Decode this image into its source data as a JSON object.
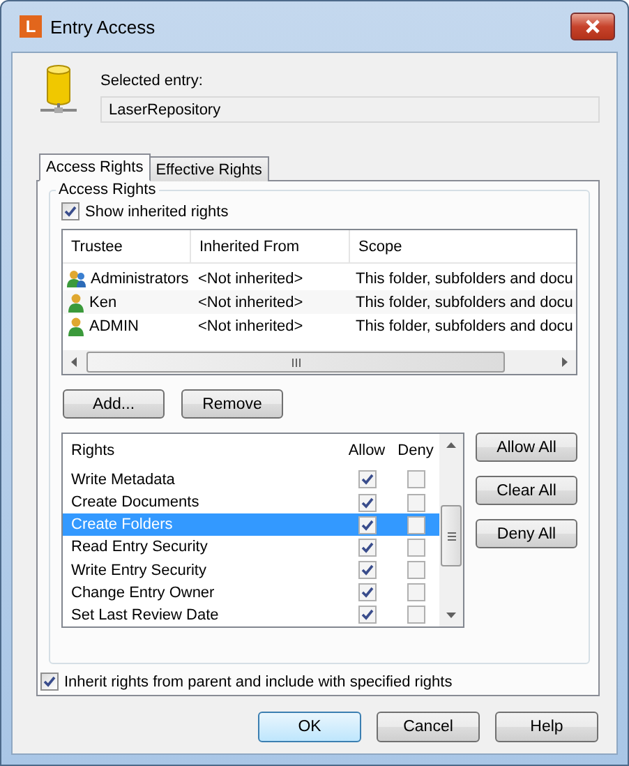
{
  "window": {
    "title": "Entry Access",
    "app_icon_letter": "L"
  },
  "selected_entry": {
    "label": "Selected entry:",
    "value": "LaserRepository"
  },
  "tabs": [
    {
      "label": "Access Rights",
      "selected": true
    },
    {
      "label": "Effective Rights",
      "selected": false
    }
  ],
  "group_label": "Access Rights",
  "show_inherited": {
    "label": "Show inherited rights",
    "checked": true
  },
  "trustees": {
    "columns": [
      "Trustee",
      "Inherited From",
      "Scope"
    ],
    "rows": [
      {
        "kind": "group",
        "trustee": "Administrators",
        "inherited_from": "<Not inherited>",
        "scope": "This folder, subfolders and docu"
      },
      {
        "kind": "user",
        "trustee": "Ken",
        "inherited_from": "<Not inherited>",
        "scope": "This folder, subfolders and docu"
      },
      {
        "kind": "user",
        "trustee": "ADMIN",
        "inherited_from": "<Not inherited>",
        "scope": "This folder, subfolders and docu"
      }
    ]
  },
  "trustee_buttons": [
    "Add...",
    "Remove"
  ],
  "rights": {
    "columns": [
      "Rights",
      "Allow",
      "Deny"
    ],
    "rows": [
      {
        "name": "Write Metadata",
        "allow": true,
        "deny": false,
        "selected": false
      },
      {
        "name": "Create Documents",
        "allow": true,
        "deny": false,
        "selected": false
      },
      {
        "name": "Create Folders",
        "allow": true,
        "deny": false,
        "selected": true
      },
      {
        "name": "Read Entry Security",
        "allow": true,
        "deny": false,
        "selected": false
      },
      {
        "name": "Write Entry Security",
        "allow": true,
        "deny": false,
        "selected": false
      },
      {
        "name": "Change Entry Owner",
        "allow": true,
        "deny": false,
        "selected": false
      },
      {
        "name": "Set Last Review Date",
        "allow": true,
        "deny": false,
        "selected": false
      }
    ]
  },
  "rights_buttons": [
    "Allow All",
    "Clear All",
    "Deny All"
  ],
  "inherit": {
    "label": "Inherit rights from parent and include with specified rights",
    "checked": true
  },
  "footer_buttons": [
    {
      "label": "OK",
      "default": true
    },
    {
      "label": "Cancel",
      "default": false
    },
    {
      "label": "Help",
      "default": false
    }
  ]
}
